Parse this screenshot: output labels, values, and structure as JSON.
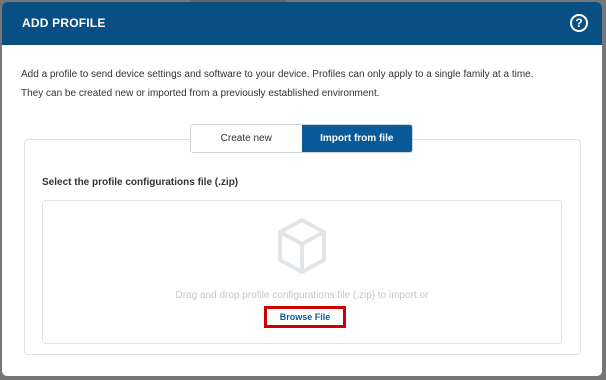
{
  "dialog": {
    "title": "ADD PROFILE",
    "help_icon": "?",
    "description_line1": "Add a profile to send device settings and software to your device. Profiles can only apply to a single family at a time.",
    "description_line2": "They can be created new or imported from a previously established environment."
  },
  "tabs": [
    {
      "label": "Create new",
      "active": false
    },
    {
      "label": "Import from file",
      "active": true
    }
  ],
  "import": {
    "select_label": "Select the profile configurations file (.zip)",
    "drop_text": "Drag and drop profile configurations file (.zip) to import or",
    "browse_label": "Browse File",
    "icon": "box-icon"
  },
  "colors": {
    "header": "#0a4f83",
    "active_tab": "#0a5a99",
    "highlight": "#cc0000"
  }
}
